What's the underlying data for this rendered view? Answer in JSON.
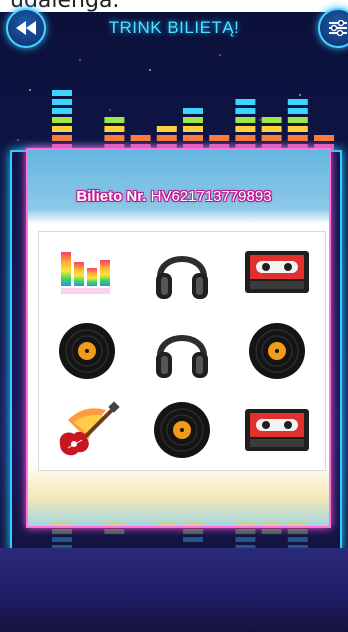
{
  "header": {
    "cut_text": "udalenga.",
    "title": "TRINK BILIETĄ!",
    "back_icon": "rewind-icon",
    "settings_icon": "sliders-icon"
  },
  "ticket": {
    "label": "Bilieto Nr.",
    "number": "HV621713779893"
  },
  "symbols": [
    {
      "name": "equalizer-icon"
    },
    {
      "name": "headphones-icon"
    },
    {
      "name": "cassette-icon"
    },
    {
      "name": "vinyl-record-icon"
    },
    {
      "name": "headphones-icon"
    },
    {
      "name": "vinyl-record-icon"
    },
    {
      "name": "electric-guitar-icon"
    },
    {
      "name": "vinyl-record-icon"
    },
    {
      "name": "cassette-icon"
    }
  ],
  "colors": {
    "accent": "#4fe3ff",
    "ticket_border": "#ff74e0",
    "background": "#121a52"
  }
}
